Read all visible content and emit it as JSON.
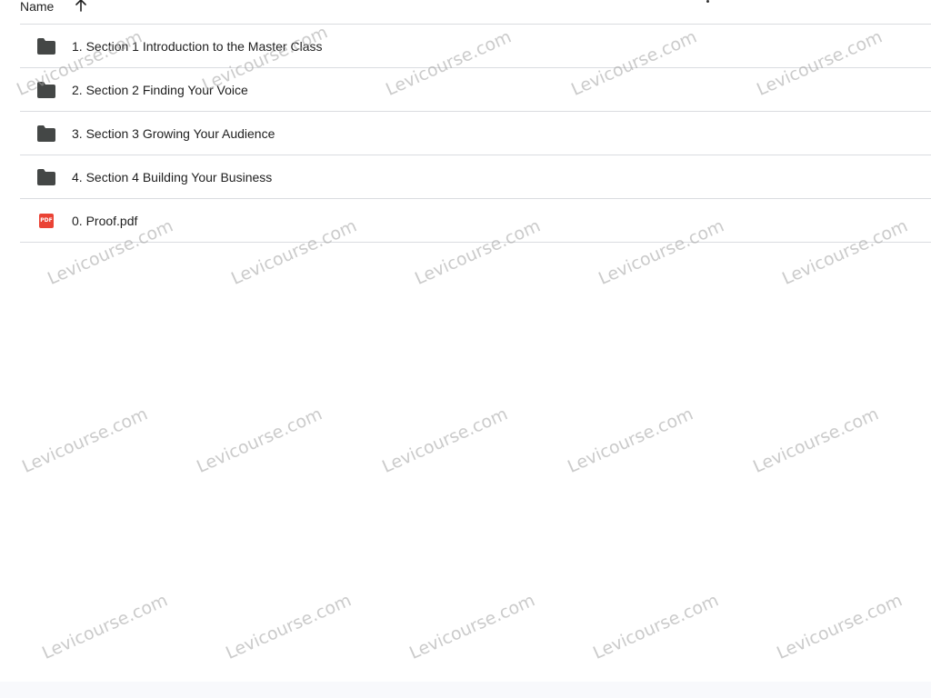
{
  "header": {
    "name_label": "Name",
    "sort_icon": "arrow-up-icon"
  },
  "files": [
    {
      "type": "folder",
      "icon": "folder-icon",
      "name": "1. Section 1 Introduction to the Master Class"
    },
    {
      "type": "folder",
      "icon": "folder-icon",
      "name": "2. Section 2 Finding Your Voice"
    },
    {
      "type": "folder",
      "icon": "folder-icon",
      "name": "3. Section 3 Growing Your Audience"
    },
    {
      "type": "folder",
      "icon": "folder-icon",
      "name": "4. Section 4 Building Your Business"
    },
    {
      "type": "pdf",
      "icon": "pdf-icon",
      "icon_text": "PDF",
      "name": "0. Proof.pdf"
    }
  ],
  "watermark_text": "Levicourse.com",
  "colors": {
    "folder": "#444746",
    "pdf": "#ea4335",
    "divider": "#dadce0",
    "text": "#1f1f1f"
  }
}
